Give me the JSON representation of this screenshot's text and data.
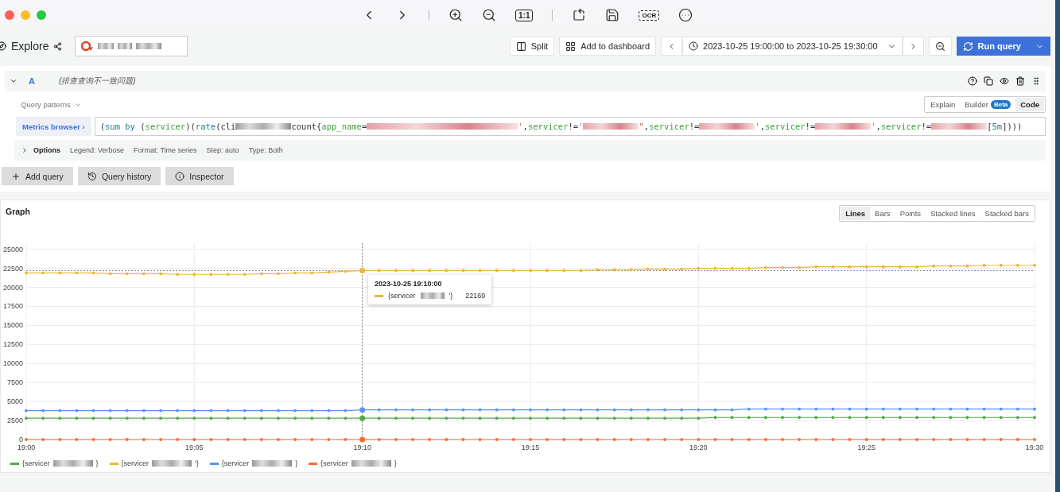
{
  "viewer_toolbar": [
    {
      "kind": "back"
    },
    {
      "kind": "forward"
    },
    {
      "kind": "divider"
    },
    {
      "kind": "zoom-in"
    },
    {
      "kind": "zoom-out"
    },
    {
      "kind": "label",
      "label": "1:1"
    },
    {
      "kind": "divider"
    },
    {
      "kind": "rotate"
    },
    {
      "kind": "save"
    },
    {
      "kind": "label",
      "label": "OCR"
    },
    {
      "kind": "more"
    }
  ],
  "explore_bar": {
    "title": "Explore",
    "split": "Split",
    "add_to_dashboard": "Add to dashboard",
    "time_range": "2023-10-25 19:00:00 to 2023-10-25 19:30:00",
    "run_query": "Run query"
  },
  "query": {
    "ref": "A",
    "note": "(排查查询不一致问题)",
    "patterns_label": "Query patterns",
    "modes": [
      {
        "label": "Explain",
        "selected": false
      },
      {
        "label": "Builder",
        "badge": "Beta",
        "selected": false
      },
      {
        "label": "Code",
        "selected": true
      }
    ],
    "metrics_browser": "Metrics browser ›",
    "expression": [
      {
        "kind": "plain",
        "text": "("
      },
      {
        "kind": "keyword",
        "text": "sum by"
      },
      {
        "kind": "plain",
        "text": " ("
      },
      {
        "kind": "label",
        "text": "servicer"
      },
      {
        "kind": "plain",
        "text": ")("
      },
      {
        "kind": "keyword",
        "text": "rate"
      },
      {
        "kind": "plain",
        "text": "(cli"
      },
      {
        "kind": "mask"
      },
      {
        "kind": "plain",
        "text": "count{"
      },
      {
        "kind": "label",
        "text": "app_name"
      },
      {
        "kind": "plain",
        "text": "="
      },
      {
        "kind": "mask-string"
      },
      {
        "kind": "string",
        "text": "'"
      },
      {
        "kind": "plain",
        "text": ","
      },
      {
        "kind": "label",
        "text": "servicer"
      },
      {
        "kind": "plain",
        "text": "!="
      },
      {
        "kind": "string",
        "text": "'"
      },
      {
        "kind": "mask-string"
      },
      {
        "kind": "string",
        "text": "\""
      },
      {
        "kind": "plain",
        "text": ","
      },
      {
        "kind": "label",
        "text": "servicer"
      },
      {
        "kind": "plain",
        "text": "!="
      },
      {
        "kind": "mask-string"
      },
      {
        "kind": "string",
        "text": "'"
      },
      {
        "kind": "plain",
        "text": ","
      },
      {
        "kind": "label",
        "text": "servicer"
      },
      {
        "kind": "plain",
        "text": "!="
      },
      {
        "kind": "mask-string"
      },
      {
        "kind": "string",
        "text": "'"
      },
      {
        "kind": "plain",
        "text": ","
      },
      {
        "kind": "label",
        "text": "servicer"
      },
      {
        "kind": "plain",
        "text": "!="
      },
      {
        "kind": "mask-string"
      },
      {
        "kind": "plain",
        "text": "["
      },
      {
        "kind": "number",
        "text": "5m"
      },
      {
        "kind": "plain",
        "text": "])))"
      }
    ],
    "options_label": "Options",
    "options": [
      "Legend: Verbose",
      "Format: Time series",
      "Step: auto",
      "Type: Both"
    ]
  },
  "actions": [
    "Add query",
    "Query history",
    "Inspector"
  ],
  "graph": {
    "title": "Graph",
    "types": [
      {
        "label": "Lines",
        "selected": true
      },
      {
        "label": "Bars",
        "selected": false
      },
      {
        "label": "Points",
        "selected": false
      },
      {
        "label": "Stacked lines",
        "selected": false
      },
      {
        "label": "Stacked bars",
        "selected": false
      }
    ],
    "chart_data": {
      "type": "line",
      "grid": true,
      "ref_lines": [
        {
          "axis": "y",
          "value": 22200
        }
      ],
      "ylim": [
        0,
        25800
      ],
      "yticks": [
        0,
        2500,
        5000,
        7500,
        10000,
        12500,
        15000,
        17500,
        20000,
        22500,
        25000
      ],
      "categories": [
        "19:00",
        null,
        null,
        null,
        null,
        null,
        null,
        null,
        null,
        null,
        "19:05",
        null,
        null,
        null,
        null,
        null,
        null,
        null,
        null,
        null,
        "19:10",
        null,
        null,
        null,
        null,
        null,
        null,
        null,
        null,
        null,
        "19:15",
        null,
        null,
        null,
        null,
        null,
        null,
        null,
        null,
        null,
        "19:20",
        null,
        null,
        null,
        null,
        null,
        null,
        null,
        null,
        null,
        "19:25",
        null,
        null,
        null,
        null,
        null,
        null,
        null,
        null,
        null,
        "19:30"
      ],
      "series": [
        {
          "name": "{servicer",
          "color": "#56a64b",
          "values": [
            2800,
            2800,
            2800,
            2800,
            2800,
            2800,
            2800,
            2800,
            2800,
            2800,
            2800,
            2800,
            2800,
            2800,
            2800,
            2800,
            2800,
            2800,
            2800,
            2800,
            2800,
            2800,
            2800,
            2800,
            2800,
            2800,
            2800,
            2800,
            2800,
            2800,
            2800,
            2800,
            2800,
            2800,
            2800,
            2800,
            2800,
            2800,
            2800,
            2800,
            2800,
            2900,
            2900,
            2900,
            2900,
            2900,
            2900,
            2900,
            2900,
            2900,
            2900,
            2900,
            2900,
            2900,
            2900,
            2900,
            2900,
            2900,
            2900,
            2900,
            2900
          ]
        },
        {
          "name": "{servicer",
          "color": "#eab839",
          "values": [
            21900,
            21900,
            21900,
            21900,
            21900,
            21800,
            21800,
            21800,
            21800,
            21700,
            21700,
            21700,
            21700,
            21700,
            21800,
            21800,
            21900,
            21900,
            22000,
            22100,
            22200,
            22200,
            22200,
            22200,
            22200,
            22200,
            22200,
            22200,
            22200,
            22200,
            22200,
            22200,
            22200,
            22200,
            22300,
            22300,
            22300,
            22400,
            22400,
            22400,
            22500,
            22500,
            22500,
            22500,
            22600,
            22600,
            22600,
            22700,
            22700,
            22700,
            22700,
            22700,
            22700,
            22700,
            22800,
            22800,
            22800,
            22900,
            22900,
            22900,
            22900
          ]
        },
        {
          "name": "{servicer",
          "color": "#5794f2",
          "values": [
            3800,
            3800,
            3800,
            3800,
            3800,
            3800,
            3800,
            3800,
            3800,
            3800,
            3800,
            3800,
            3800,
            3800,
            3800,
            3800,
            3800,
            3800,
            3800,
            3800,
            3900,
            3900,
            3900,
            3900,
            3900,
            3900,
            3900,
            3900,
            3900,
            3900,
            3900,
            3900,
            3900,
            3900,
            3900,
            3900,
            3900,
            3900,
            3900,
            3900,
            3900,
            3900,
            3900,
            4000,
            4000,
            4000,
            4000,
            4000,
            4000,
            4000,
            4000,
            4000,
            4000,
            4000,
            4000,
            4000,
            4000,
            4000,
            4000,
            4000,
            4000
          ]
        },
        {
          "name": "{servicer",
          "color": "#ff6a2b",
          "values": [
            0,
            0,
            0,
            0,
            0,
            0,
            0,
            0,
            0,
            0,
            0,
            0,
            0,
            0,
            0,
            0,
            0,
            0,
            0,
            0,
            0,
            0,
            0,
            0,
            0,
            0,
            0,
            0,
            0,
            0,
            0,
            0,
            0,
            0,
            0,
            0,
            0,
            0,
            0,
            0,
            0,
            0,
            0,
            0,
            0,
            0,
            0,
            0,
            0,
            0,
            0,
            0,
            0,
            0,
            0,
            0,
            0,
            0,
            0,
            0,
            0
          ]
        }
      ]
    },
    "legend": [
      {
        "suffix": "}"
      },
      {
        "suffix": "'}"
      },
      {
        "suffix": " }"
      },
      {
        "suffix": "}"
      }
    ],
    "tooltip": {
      "time": "2023-10-25 19:10:00",
      "label": "{servicer",
      "suffix": "'}",
      "value": "22169"
    }
  }
}
